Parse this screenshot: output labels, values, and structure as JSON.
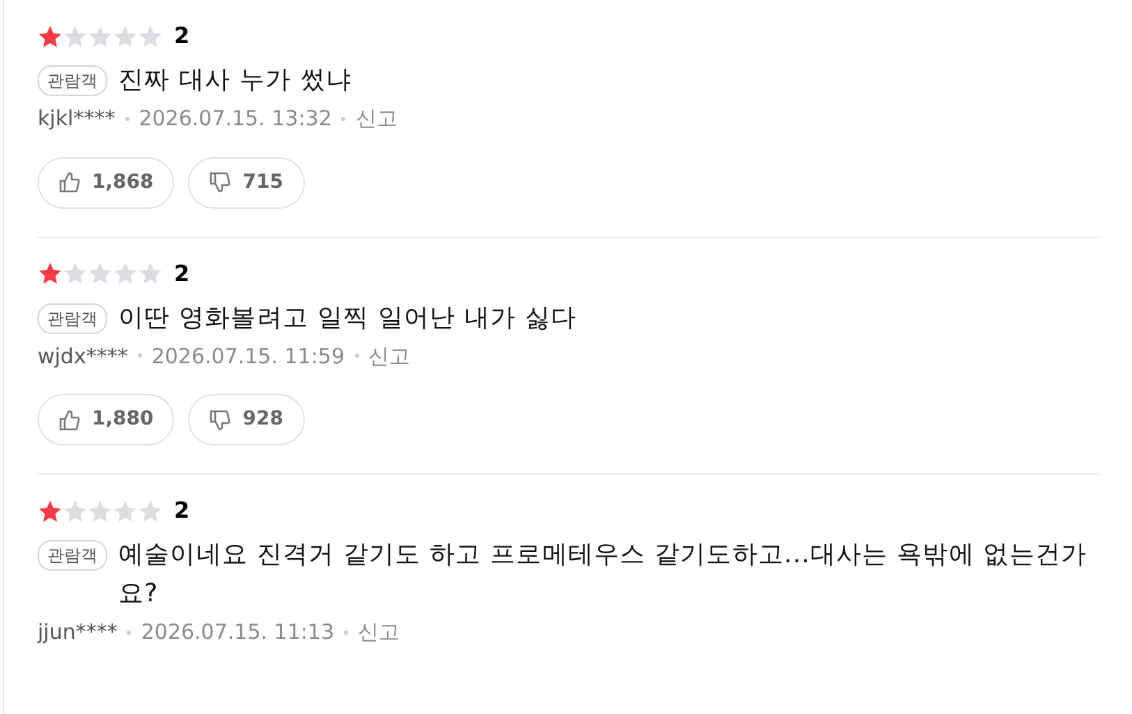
{
  "reviews": [
    {
      "stars": 1,
      "score": "2",
      "badge": "관람객",
      "text": "진짜 대사 누가 썼냐",
      "author": "kjkl****",
      "date": "2026.07.15. 13:32",
      "report": "신고",
      "likes": "1,868",
      "dislikes": "715"
    },
    {
      "stars": 1,
      "score": "2",
      "badge": "관람객",
      "text": "이딴 영화볼려고 일찍 일어난 내가 싫다",
      "author": "wjdx****",
      "date": "2026.07.15. 11:59",
      "report": "신고",
      "likes": "1,880",
      "dislikes": "928"
    },
    {
      "stars": 1,
      "score": "2",
      "badge": "관람객",
      "text": "예술이네요 진격거 같기도 하고 프로메테우스 같기도하고...대사는 욕밖에 없는건가요?",
      "author": "jjun****",
      "date": "2026.07.15. 11:13",
      "report": "신고"
    }
  ]
}
